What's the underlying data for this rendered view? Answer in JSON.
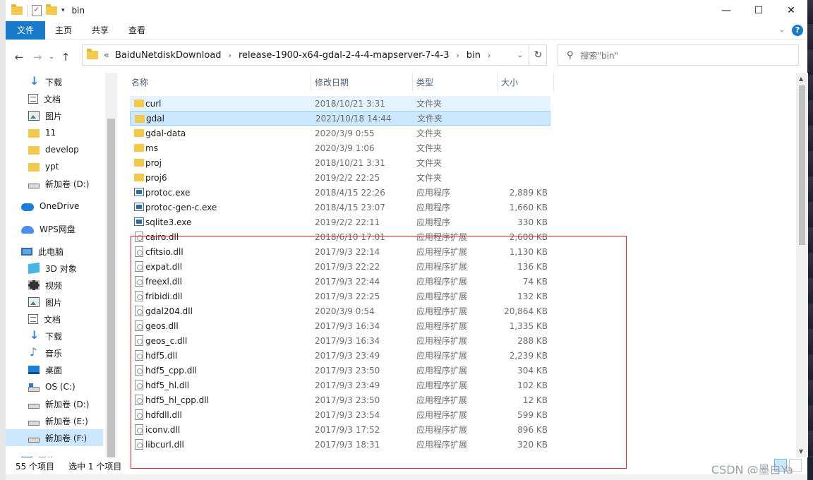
{
  "window": {
    "title": "bin",
    "buttons": {
      "minimize": "—",
      "maximize": "☐",
      "close": "✕"
    }
  },
  "ribbon": {
    "tabs": [
      "文件",
      "主页",
      "共享",
      "查看"
    ],
    "help": "?"
  },
  "address": {
    "prefix": "«",
    "crumbs": [
      "BaiduNetdiskDownload",
      "release-1900-x64-gdal-2-4-4-mapserver-7-4-3",
      "bin"
    ]
  },
  "search": {
    "placeholder": "搜索\"bin\""
  },
  "nav": {
    "items": [
      {
        "label": "下载",
        "icon": "download-icon",
        "pinned": true
      },
      {
        "label": "文档",
        "icon": "document-icon",
        "pinned": true
      },
      {
        "label": "图片",
        "icon": "picture-icon",
        "pinned": true
      },
      {
        "label": "11",
        "icon": "folder-icon"
      },
      {
        "label": "develop",
        "icon": "folder-icon"
      },
      {
        "label": "ypt",
        "icon": "folder-icon"
      },
      {
        "label": "新加卷 (D:)",
        "icon": "drive-icon"
      },
      {
        "label": "OneDrive",
        "icon": "onedrive-icon"
      },
      {
        "label": "WPS网盘",
        "icon": "wps-cloud-icon"
      },
      {
        "label": "此电脑",
        "icon": "this-pc-icon"
      },
      {
        "label": "3D 对象",
        "icon": "3d-objects-icon"
      },
      {
        "label": "视频",
        "icon": "video-icon"
      },
      {
        "label": "图片",
        "icon": "picture-icon"
      },
      {
        "label": "文档",
        "icon": "document-icon"
      },
      {
        "label": "下载",
        "icon": "download-icon"
      },
      {
        "label": "音乐",
        "icon": "music-icon"
      },
      {
        "label": "桌面",
        "icon": "desktop-icon"
      },
      {
        "label": "OS (C:)",
        "icon": "os-drive-icon"
      },
      {
        "label": "新加卷 (D:)",
        "icon": "drive-icon"
      },
      {
        "label": "新加卷 (E:)",
        "icon": "drive-icon"
      },
      {
        "label": "新加卷 (F:)",
        "icon": "drive-icon",
        "selected": true
      },
      {
        "label": "网络",
        "icon": "network-icon"
      }
    ]
  },
  "columns": {
    "name": "名称",
    "date": "修改日期",
    "type": "类型",
    "size": "大小"
  },
  "files": [
    {
      "name": "curl",
      "date": "2018/10/21 3:31",
      "type": "文件夹",
      "size": "",
      "kind": "folder",
      "state": "hover"
    },
    {
      "name": "gdal",
      "date": "2021/10/18 14:44",
      "type": "文件夹",
      "size": "",
      "kind": "folder",
      "state": "selected"
    },
    {
      "name": "gdal-data",
      "date": "2020/3/9 0:55",
      "type": "文件夹",
      "size": "",
      "kind": "folder"
    },
    {
      "name": "ms",
      "date": "2020/3/9 1:06",
      "type": "文件夹",
      "size": "",
      "kind": "folder"
    },
    {
      "name": "proj",
      "date": "2018/10/21 3:31",
      "type": "文件夹",
      "size": "",
      "kind": "folder"
    },
    {
      "name": "proj6",
      "date": "2019/2/2 22:25",
      "type": "文件夹",
      "size": "",
      "kind": "folder"
    },
    {
      "name": "protoc.exe",
      "date": "2018/4/15 22:26",
      "type": "应用程序",
      "size": "2,889 KB",
      "kind": "exe"
    },
    {
      "name": "protoc-gen-c.exe",
      "date": "2018/4/15 23:07",
      "type": "应用程序",
      "size": "1,660 KB",
      "kind": "exe"
    },
    {
      "name": "sqlite3.exe",
      "date": "2019/2/2 22:11",
      "type": "应用程序",
      "size": "330 KB",
      "kind": "exe"
    },
    {
      "name": "cairo.dll",
      "date": "2018/6/10 17:01",
      "type": "应用程序扩展",
      "size": "2,600 KB",
      "kind": "dll"
    },
    {
      "name": "cfitsio.dll",
      "date": "2017/9/3 22:14",
      "type": "应用程序扩展",
      "size": "1,130 KB",
      "kind": "dll"
    },
    {
      "name": "expat.dll",
      "date": "2017/9/3 22:22",
      "type": "应用程序扩展",
      "size": "136 KB",
      "kind": "dll"
    },
    {
      "name": "freexl.dll",
      "date": "2017/9/3 22:44",
      "type": "应用程序扩展",
      "size": "74 KB",
      "kind": "dll"
    },
    {
      "name": "fribidi.dll",
      "date": "2017/9/3 22:25",
      "type": "应用程序扩展",
      "size": "132 KB",
      "kind": "dll"
    },
    {
      "name": "gdal204.dll",
      "date": "2020/3/9 0:54",
      "type": "应用程序扩展",
      "size": "20,864 KB",
      "kind": "dll"
    },
    {
      "name": "geos.dll",
      "date": "2017/9/3 16:34",
      "type": "应用程序扩展",
      "size": "1,335 KB",
      "kind": "dll"
    },
    {
      "name": "geos_c.dll",
      "date": "2017/9/3 16:34",
      "type": "应用程序扩展",
      "size": "288 KB",
      "kind": "dll"
    },
    {
      "name": "hdf5.dll",
      "date": "2017/9/3 23:49",
      "type": "应用程序扩展",
      "size": "2,239 KB",
      "kind": "dll"
    },
    {
      "name": "hdf5_cpp.dll",
      "date": "2017/9/3 23:50",
      "type": "应用程序扩展",
      "size": "304 KB",
      "kind": "dll"
    },
    {
      "name": "hdf5_hl.dll",
      "date": "2017/9/3 23:49",
      "type": "应用程序扩展",
      "size": "102 KB",
      "kind": "dll"
    },
    {
      "name": "hdf5_hl_cpp.dll",
      "date": "2017/9/3 23:50",
      "type": "应用程序扩展",
      "size": "12 KB",
      "kind": "dll"
    },
    {
      "name": "hdfdll.dll",
      "date": "2017/9/3 23:54",
      "type": "应用程序扩展",
      "size": "599 KB",
      "kind": "dll"
    },
    {
      "name": "iconv.dll",
      "date": "2017/9/3 17:52",
      "type": "应用程序扩展",
      "size": "896 KB",
      "kind": "dll"
    },
    {
      "name": "libcurl.dll",
      "date": "2017/9/3 18:31",
      "type": "应用程序扩展",
      "size": "320 KB",
      "kind": "dll"
    }
  ],
  "status": {
    "item_count": "55 个项目",
    "selected_count": "选中 1 个项目"
  },
  "watermark": "CSDN @墨白Ya",
  "colors": {
    "accent": "#1979ca",
    "selection": "#cce8ff",
    "annotation_box": "#e02020"
  }
}
